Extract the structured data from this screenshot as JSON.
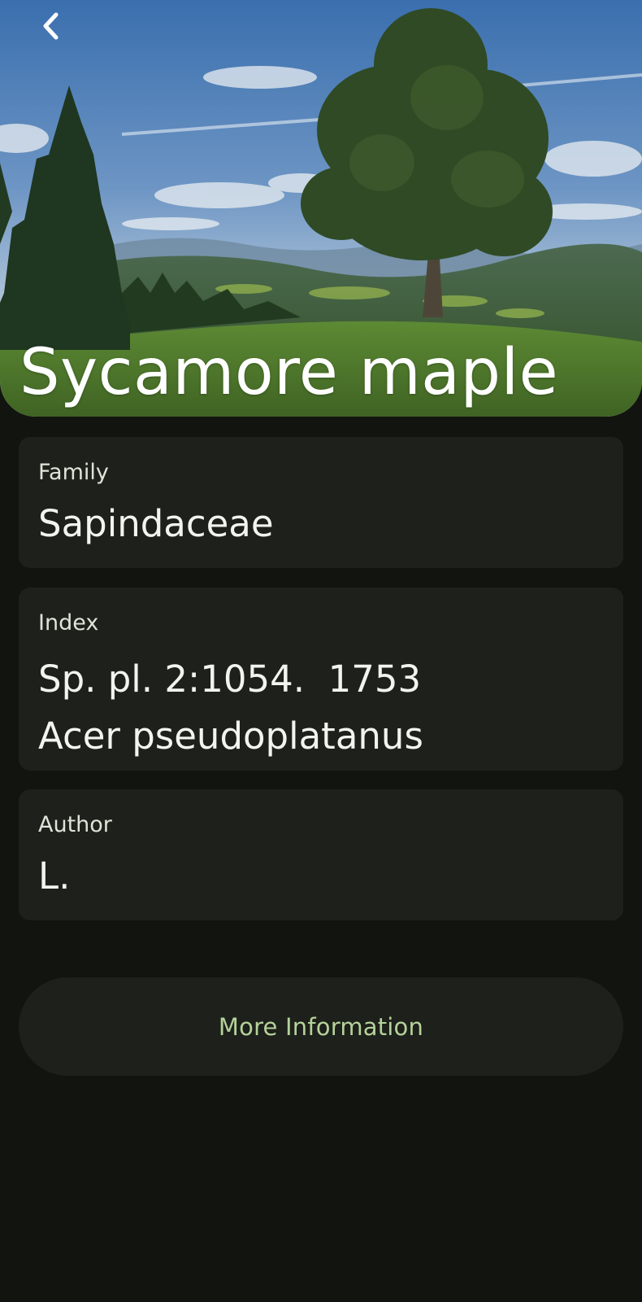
{
  "header": {
    "title": "Sycamore maple",
    "back_icon": "chevron-left-icon"
  },
  "cards": {
    "family": {
      "label": "Family",
      "value": "Sapindaceae"
    },
    "index": {
      "label": "Index",
      "lines": [
        "Sp. pl. 2:1054.  1753",
        "Acer pseudoplatanus"
      ]
    },
    "author": {
      "label": "Author",
      "value": "L."
    }
  },
  "actions": {
    "more_info_label": "More Information"
  },
  "colors": {
    "background": "#12140f",
    "card": "#1e201b",
    "accent": "#b5d29a",
    "text": "#f2f4ee"
  }
}
